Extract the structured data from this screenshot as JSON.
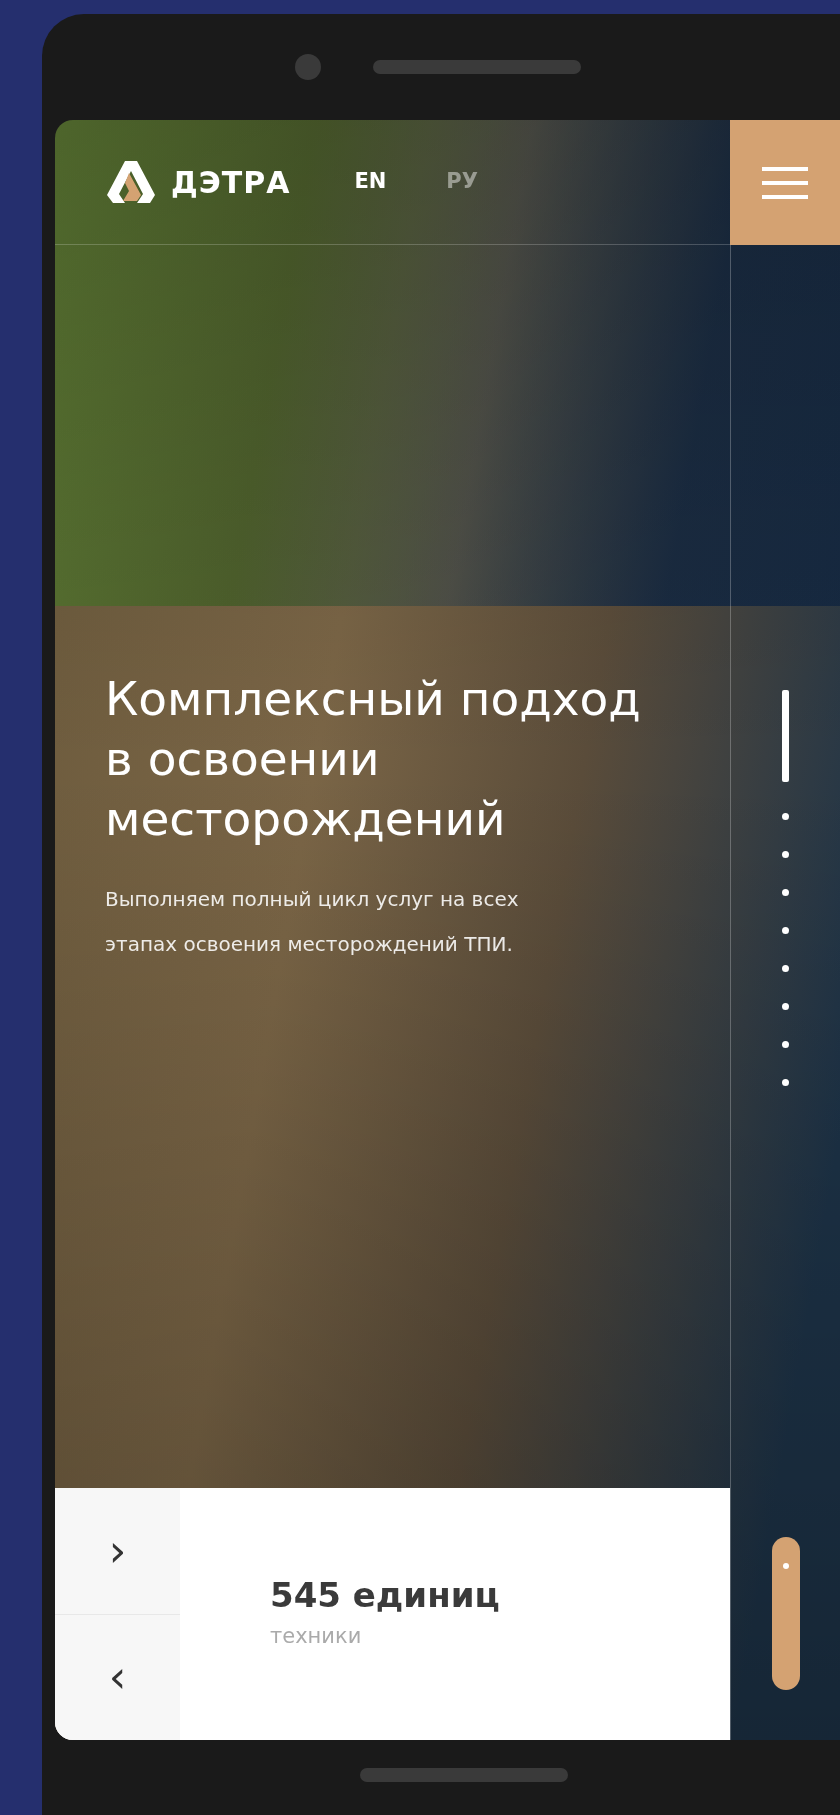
{
  "header": {
    "logo": "ДЭТРА",
    "languages": [
      {
        "label": "EN",
        "selected": true
      },
      {
        "label": "РУ",
        "selected": false
      }
    ]
  },
  "hero": {
    "title": "Комплексный подход в освоении месторождений",
    "text": "Выполняем полный цикл услуг на всех этапах освоения месторождений ТПИ."
  },
  "pager": [
    {
      "selected": true
    },
    {
      "selected": false
    },
    {
      "selected": false
    },
    {
      "selected": false
    },
    {
      "selected": false
    },
    {
      "selected": false
    },
    {
      "selected": false
    },
    {
      "selected": false
    },
    {
      "selected": false
    }
  ],
  "stat": {
    "value": "545 единиц",
    "label": "техники"
  },
  "stat_nav": [
    "›",
    "‹"
  ]
}
